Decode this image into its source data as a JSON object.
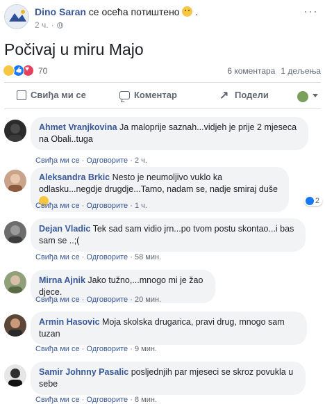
{
  "post": {
    "author": "Dino Saran",
    "feeling": "се осећа потиштено",
    "time": "2 ч.",
    "more_icon": "ellipsis-icon",
    "text": "Počivaj u miru Majo",
    "reaction_count": "70",
    "comment_count": "6 коментара",
    "share_count": "1 дељења"
  },
  "actions": {
    "like": "Свиђа ми се",
    "comment": "Коментар",
    "share": "Подели"
  },
  "comments": [
    {
      "name": "Ahmet Vranjkovina",
      "text": "Ja maloprije saznah...vidjeh je prije 2 mjeseca na Obali..tuga",
      "time": "2 ч."
    },
    {
      "name": "Aleksandra Brkic",
      "text": "Nesto je neumoljivo vuklo ka odlasku...negdje drugdje...Tamo, nadam se, nadje smiraj duše",
      "time": "1 ч.",
      "likes": "2"
    },
    {
      "name": "Dejan Vladic",
      "text": "Tek sad sam vidio jrn...po tvom postu skontao...i bas sam se ..;(",
      "time": "58 мин."
    },
    {
      "name": "Mirna Ajnik",
      "text": "Jako tužno,...mnogo mi je žao djece.",
      "time": "20 мин."
    },
    {
      "name": "Armin Hasovic",
      "text": "Moja skolska drugarica, pravi drug, mnogo sam tuzan",
      "time": "9 мин."
    },
    {
      "name": "Samir Johnny Pasalic",
      "text": "posljednjih par mjeseci se skroz povukla u sebe",
      "time": "8 мин."
    }
  ],
  "comment_actions": {
    "like": "Свиђа ми се",
    "reply": "Одговорите",
    "dot": "·"
  },
  "colors": {
    "link": "#385898",
    "bubble": "#f2f3f5",
    "like_blue": "#1877f2",
    "love_red": "#e4405f"
  }
}
